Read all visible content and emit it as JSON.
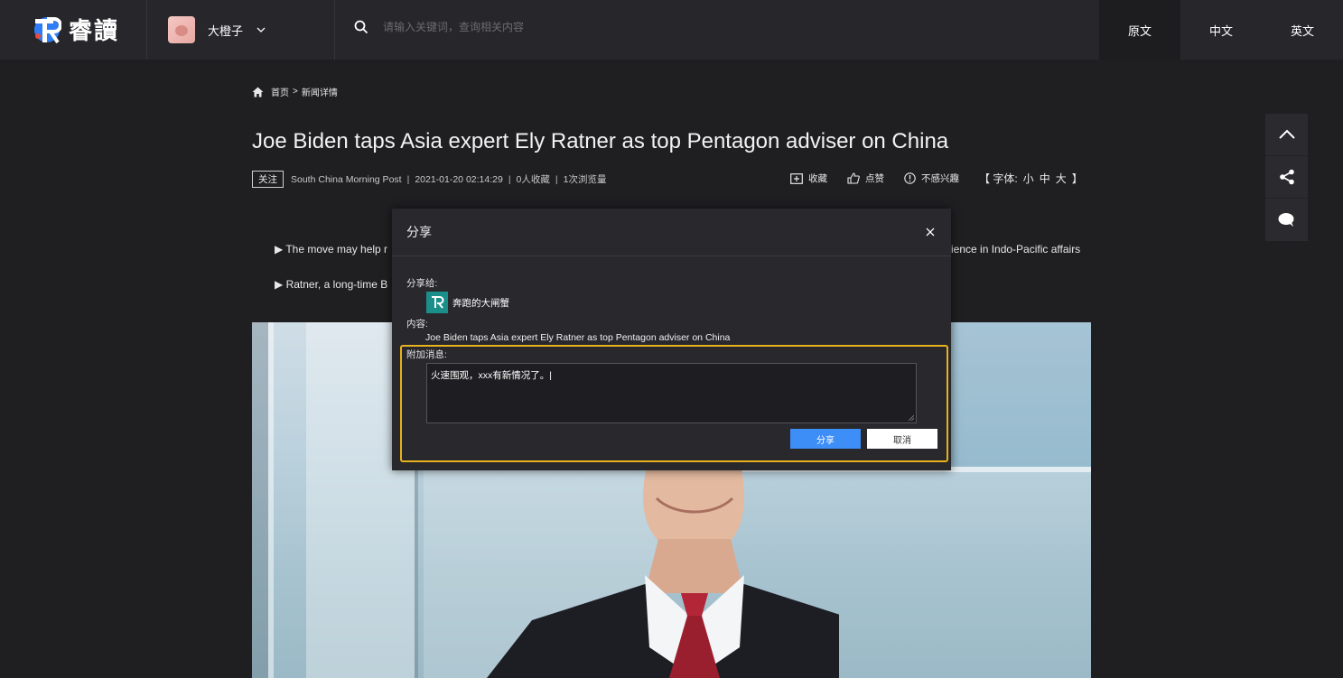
{
  "header": {
    "logo_text": "睿讀",
    "user_name": "大橙子",
    "search_placeholder": "请输入关键词，查询相关内容",
    "lang_tabs": [
      {
        "label": "原文",
        "active": true
      },
      {
        "label": "中文",
        "active": false
      },
      {
        "label": "英文",
        "active": false
      }
    ]
  },
  "breadcrumb": {
    "home": "首页",
    "separator": ">",
    "current": "新闻详情"
  },
  "article": {
    "title": "Joe Biden taps Asia expert Ely Ratner as top Pentagon adviser on China",
    "follow_label": "关注",
    "source": "South China Morning Post",
    "date": "2021-01-20 02:14:29",
    "favorites": "0人收藏",
    "views": "1次浏览量",
    "meta_separator": "|",
    "bullets": [
      {
        "prefix": "▶ The move may help r",
        "suffix": "ience in Indo-Pacific affairs"
      },
      {
        "prefix": "▶ Ratner, a long-time B",
        "suffix": ""
      }
    ]
  },
  "actions": {
    "collect": "收藏",
    "like": "点赞",
    "not_interested": "不感兴趣",
    "font_label_open": "【 字体:",
    "font_small": "小",
    "font_medium": "中",
    "font_large": "大",
    "font_label_close": "】"
  },
  "modal": {
    "title": "分享",
    "share_to_label": "分享给:",
    "recipient_name": "奔跑的大闸蟹",
    "content_label": "内容:",
    "content_text": "Joe Biden taps Asia expert Ely Ratner as top Pentagon adviser on China",
    "extra_label": "附加消息:",
    "extra_message": "火速围观，xxx有新情况了。|",
    "share_button": "分享",
    "cancel_button": "取消"
  },
  "colors": {
    "accent_blue": "#3e8ef7",
    "highlight_yellow": "#e8b21e",
    "background": "#1f1f22",
    "topbar": "#27272b",
    "brand_teal": "#1a8f8a"
  }
}
